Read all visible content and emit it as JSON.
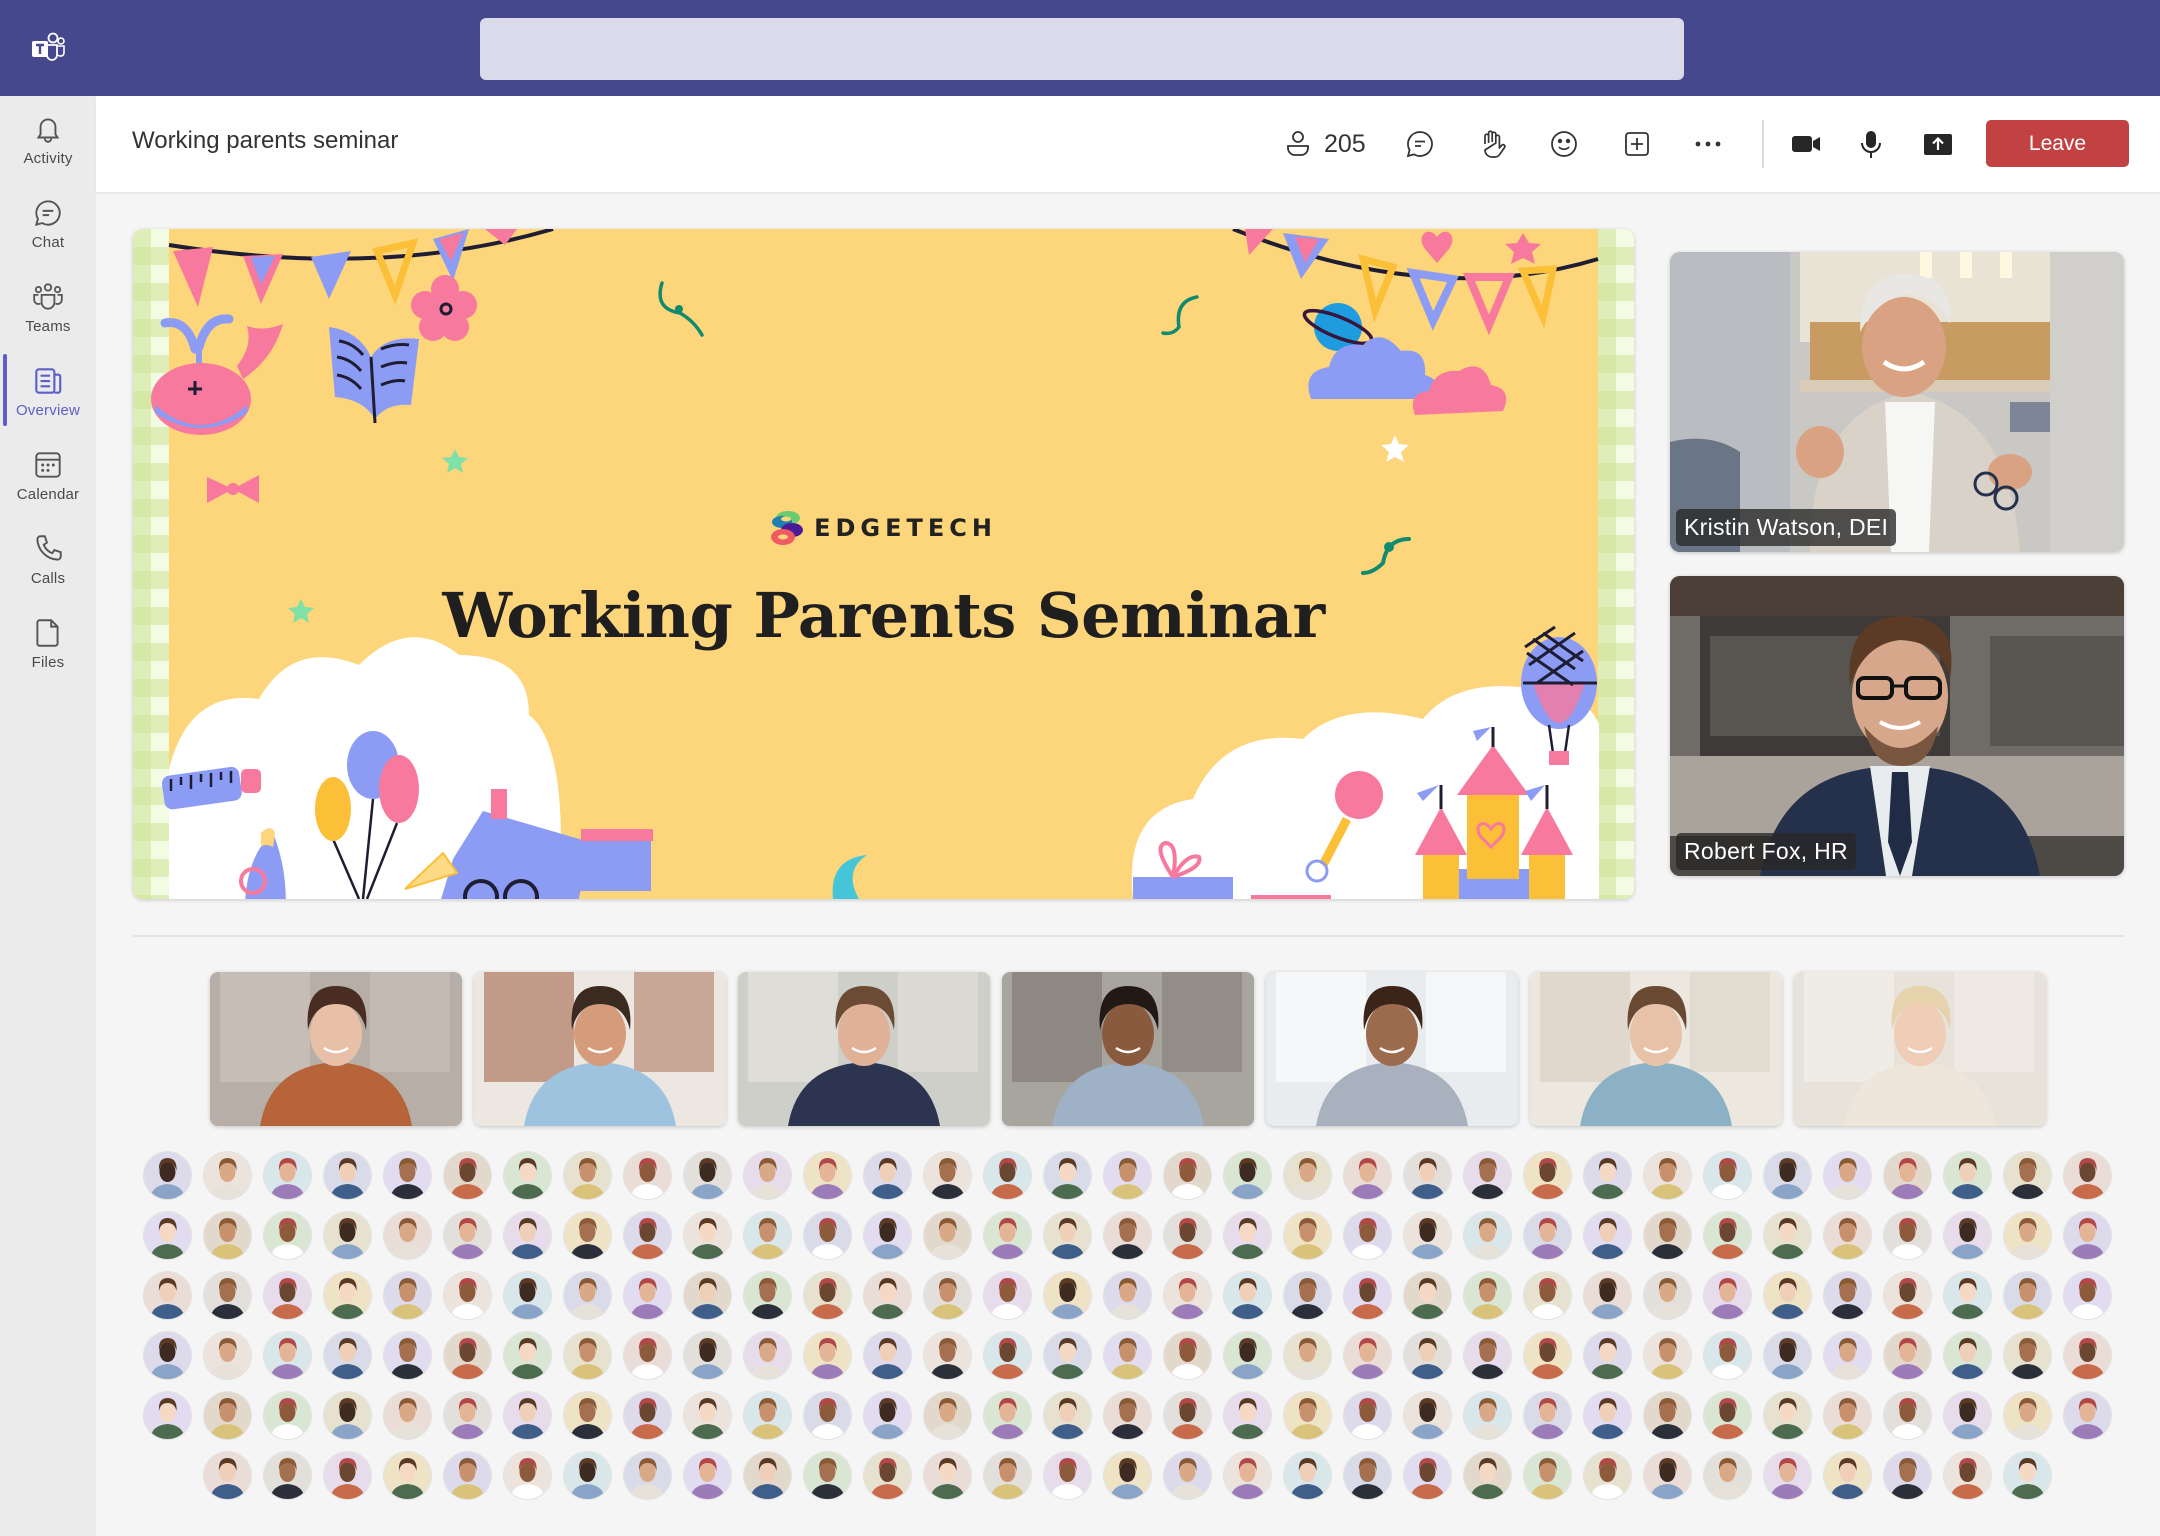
{
  "app": {
    "logo_icon": "teams-logo-icon",
    "search": {
      "placeholder": "",
      "value": ""
    }
  },
  "rail": {
    "items": [
      {
        "label": "Activity",
        "icon": "bell-icon",
        "active": false
      },
      {
        "label": "Chat",
        "icon": "chat-icon",
        "active": false
      },
      {
        "label": "Teams",
        "icon": "teams-icon",
        "active": false
      },
      {
        "label": "Overview",
        "icon": "overview-icon",
        "active": true
      },
      {
        "label": "Calendar",
        "icon": "calendar-icon",
        "active": false
      },
      {
        "label": "Calls",
        "icon": "phone-icon",
        "active": false
      },
      {
        "label": "Files",
        "icon": "file-icon",
        "active": false
      }
    ],
    "accent": "#5b5fc7"
  },
  "header": {
    "title": "Working parents seminar",
    "participant_count": "205",
    "toolbar": [
      "people-icon",
      "chat-icon",
      "raise-hand-icon",
      "reactions-icon",
      "apps-add-icon",
      "more-icon",
      "camera-icon",
      "microphone-icon",
      "share-screen-icon"
    ],
    "leave_label": "Leave",
    "leave_color": "#c24244"
  },
  "stage": {
    "slide": {
      "brand": "EDGETECH",
      "title": "Working Parents Seminar",
      "background": "#fdd57b"
    },
    "speakers": [
      {
        "name": "Kristin Watson, DEI"
      },
      {
        "name": "Robert Fox, HR"
      }
    ]
  },
  "gallery": {
    "video_tiles": 7
  },
  "audience": {
    "row_counts": [
      33,
      33,
      33,
      33,
      33,
      31
    ]
  }
}
